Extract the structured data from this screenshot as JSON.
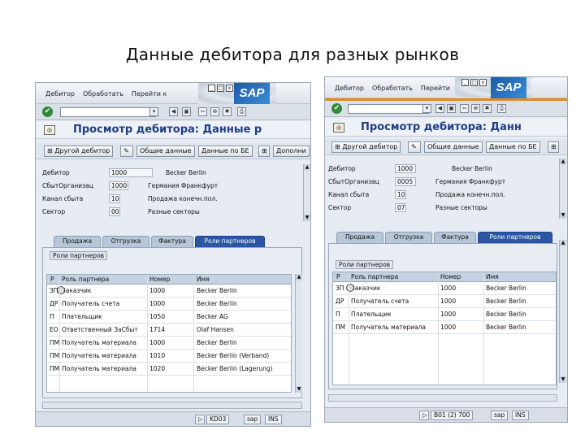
{
  "slide_title": "Данные дебитора для разных рынков",
  "left": {
    "menu": [
      "Дебитор",
      "Обработать",
      "Перейти к"
    ],
    "title": "Просмотр дебитора: Данные р",
    "appbar": [
      "Другой дебитор",
      "Общие данные",
      "Данные по БЕ",
      "Дополни"
    ],
    "fields": [
      {
        "label": "Дебитор",
        "value": "1000",
        "desc": "Becker Berlin"
      },
      {
        "label": "СбытОрганизац",
        "value": "1000",
        "desc": "Германия Франкфурт"
      },
      {
        "label": "Канал сбыта",
        "value": "10",
        "desc": "Продажа конечн.пол."
      },
      {
        "label": "Сектор",
        "value": "00",
        "desc": "Разные секторы"
      }
    ],
    "tabs": [
      "Продажа",
      "Отгрузка",
      "Фактура",
      "Роли партнеров"
    ],
    "table_title": "Роли партнеров",
    "columns": [
      "Р",
      "Роль партнера",
      "Номер",
      "Имя"
    ],
    "rows": [
      [
        "ЗП",
        "Заказчик",
        "1000",
        "Becker Berlin"
      ],
      [
        "ДР",
        "Получатель счета",
        "1000",
        "Becker Berlin"
      ],
      [
        "П",
        "Плательщик",
        "1050",
        "Becker AG"
      ],
      [
        "ЕО",
        "Ответственный ЗаСбыт",
        "1714",
        "Olaf Hansen"
      ],
      [
        "ПМ",
        "Получатель материала",
        "1000",
        "Becker Berlin"
      ],
      [
        "ПМ",
        "Получатель материала",
        "1010",
        "Becker Berlin (Verband)"
      ],
      [
        "ПМ",
        "Получатель материала",
        "1020",
        "Becker Berlin (Lagerung)"
      ]
    ],
    "status": [
      "KD03",
      "sap",
      "INS"
    ]
  },
  "right": {
    "menu": [
      "Дебитор",
      "Обработать",
      "Перейти"
    ],
    "title": "Просмотр дебитора: Данн",
    "appbar": [
      "Другой дебитор",
      "Общие данные",
      "Данные по БЕ"
    ],
    "fields": [
      {
        "label": "Дебитор",
        "value": "1000",
        "desc": "Becker Berlin"
      },
      {
        "label": "СбытОрганизац",
        "value": "0005",
        "desc": "Германия Франкфурт"
      },
      {
        "label": "Канал сбыта",
        "value": "10",
        "desc": "Продажа конечн.пол."
      },
      {
        "label": "Сектор",
        "value": "07",
        "desc": "Разные секторы"
      }
    ],
    "tabs": [
      "Продажа",
      "Отгрузка",
      "Фактура",
      "Роли партнеров"
    ],
    "table_title": "Роли партнеров",
    "columns": [
      "Р",
      "Роль партнера",
      "Номер",
      "Имя"
    ],
    "rows": [
      [
        "ЗП",
        "Заказчик",
        "1000",
        "Becker Berlin"
      ],
      [
        "ДР",
        "Получатель счета",
        "1000",
        "Becker Berlin"
      ],
      [
        "П",
        "Плательщик",
        "1000",
        "Becker Berlin"
      ],
      [
        "ПМ",
        "Получатель материала",
        "1000",
        "Becker Berlin"
      ]
    ],
    "status": [
      "B01 (2) 700",
      "sap",
      "INS"
    ]
  },
  "colors": {
    "title_blue": "#1f3d86",
    "active_tab": "#2a56a3",
    "accent_orange": "#e28b1d"
  }
}
